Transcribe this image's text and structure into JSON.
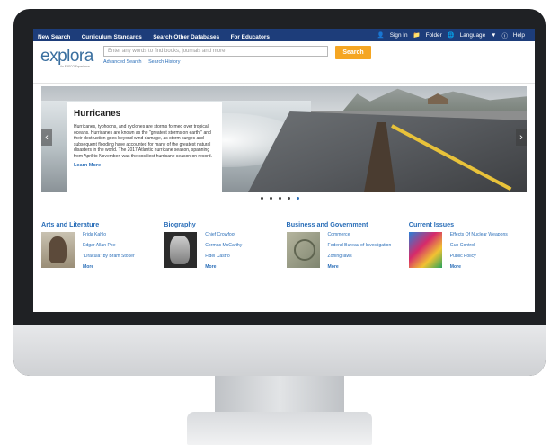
{
  "topnav": {
    "left": [
      "New Search",
      "Curriculum Standards",
      "Search Other Databases",
      "For Educators"
    ],
    "right": {
      "sign_in": "Sign In",
      "folder": "Folder",
      "language": "Language",
      "help": "Help"
    }
  },
  "logo": {
    "word": "explora",
    "sub": "An EBSCO Experience"
  },
  "search": {
    "placeholder": "Enter any words to find books, journals and more",
    "button": "Search",
    "advanced": "Advanced Search",
    "history": "Search History"
  },
  "hero": {
    "title": "Hurricanes",
    "text": "Hurricanes, typhoons, and cyclones are storms formed over tropical oceans. Hurricanes are known as the \"greatest storms on earth,\" and their destruction goes beyond wind damage, as storm surges and subsequent flooding have accounted for many of the greatest natural disasters in the world. The 2017 Atlantic hurricane season, spanning from April to November, was the costliest hurricane season on record.",
    "learn_more": "Learn More",
    "prev": "‹",
    "next": "›",
    "dots": 5,
    "active_dot": 5
  },
  "categories": [
    {
      "title": "Arts and Literature",
      "links": [
        "Frida Kahlo",
        "Edgar Allan Poe",
        "\"Dracula\" by Bram Stoker"
      ],
      "more": "More"
    },
    {
      "title": "Biography",
      "links": [
        "Chief Crowfoot",
        "Cormac McCarthy",
        "Fidel Castro"
      ],
      "more": "More"
    },
    {
      "title": "Business and Government",
      "links": [
        "Commerce",
        "Federal Bureau of Investigation",
        "Zoning laws"
      ],
      "more": "More"
    },
    {
      "title": "Current Issues",
      "links": [
        "Effects Of Nuclear Weapons",
        "Gun Control",
        "Public Policy"
      ],
      "more": "More"
    }
  ],
  "colors": {
    "nav_bg": "#1d3d7a",
    "accent": "#2a6eb8",
    "search_button": "#f5a623"
  }
}
